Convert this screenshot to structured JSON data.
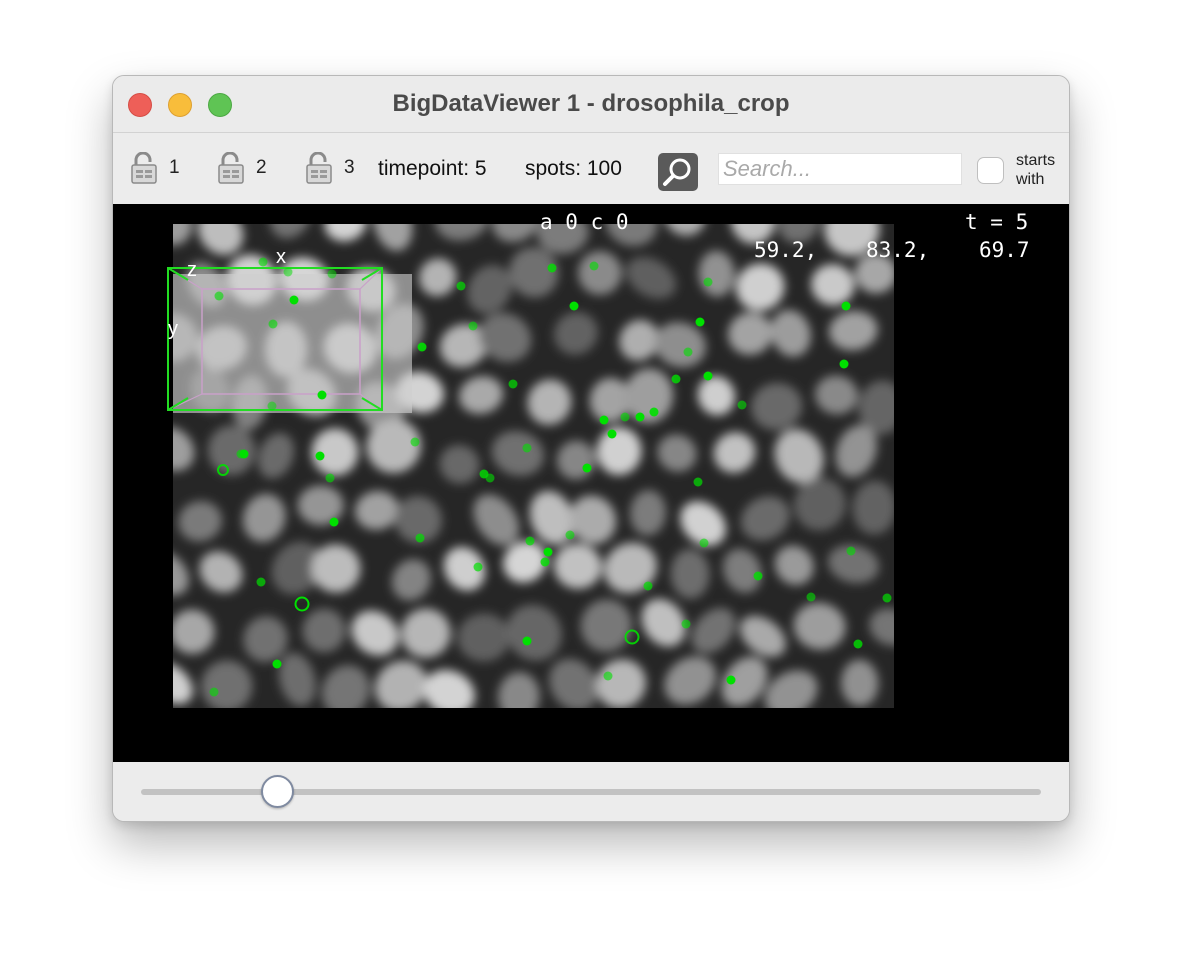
{
  "window": {
    "title": "BigDataViewer 1 - drosophila_crop"
  },
  "toolbar": {
    "locks": [
      {
        "label": "1",
        "state": "unlocked"
      },
      {
        "label": "2",
        "state": "unlocked"
      },
      {
        "label": "3",
        "state": "unlocked"
      }
    ],
    "timepoint_text": "timepoint: 5",
    "spots_text": "spots: 100",
    "search_placeholder": "Search...",
    "starts_with_line1": "starts",
    "starts_with_line2": "with",
    "starts_with_checked": false
  },
  "viewer": {
    "source_label": "a 0 c 0",
    "time_label": "t = 5",
    "coord_x": "59.2,",
    "coord_y": "83.2,",
    "coord_z": "69.7",
    "axis_x": "x",
    "axis_y": "y",
    "axis_z": "z",
    "spot_color": "#00e000"
  },
  "timeline": {
    "value_fraction": 0.15
  }
}
